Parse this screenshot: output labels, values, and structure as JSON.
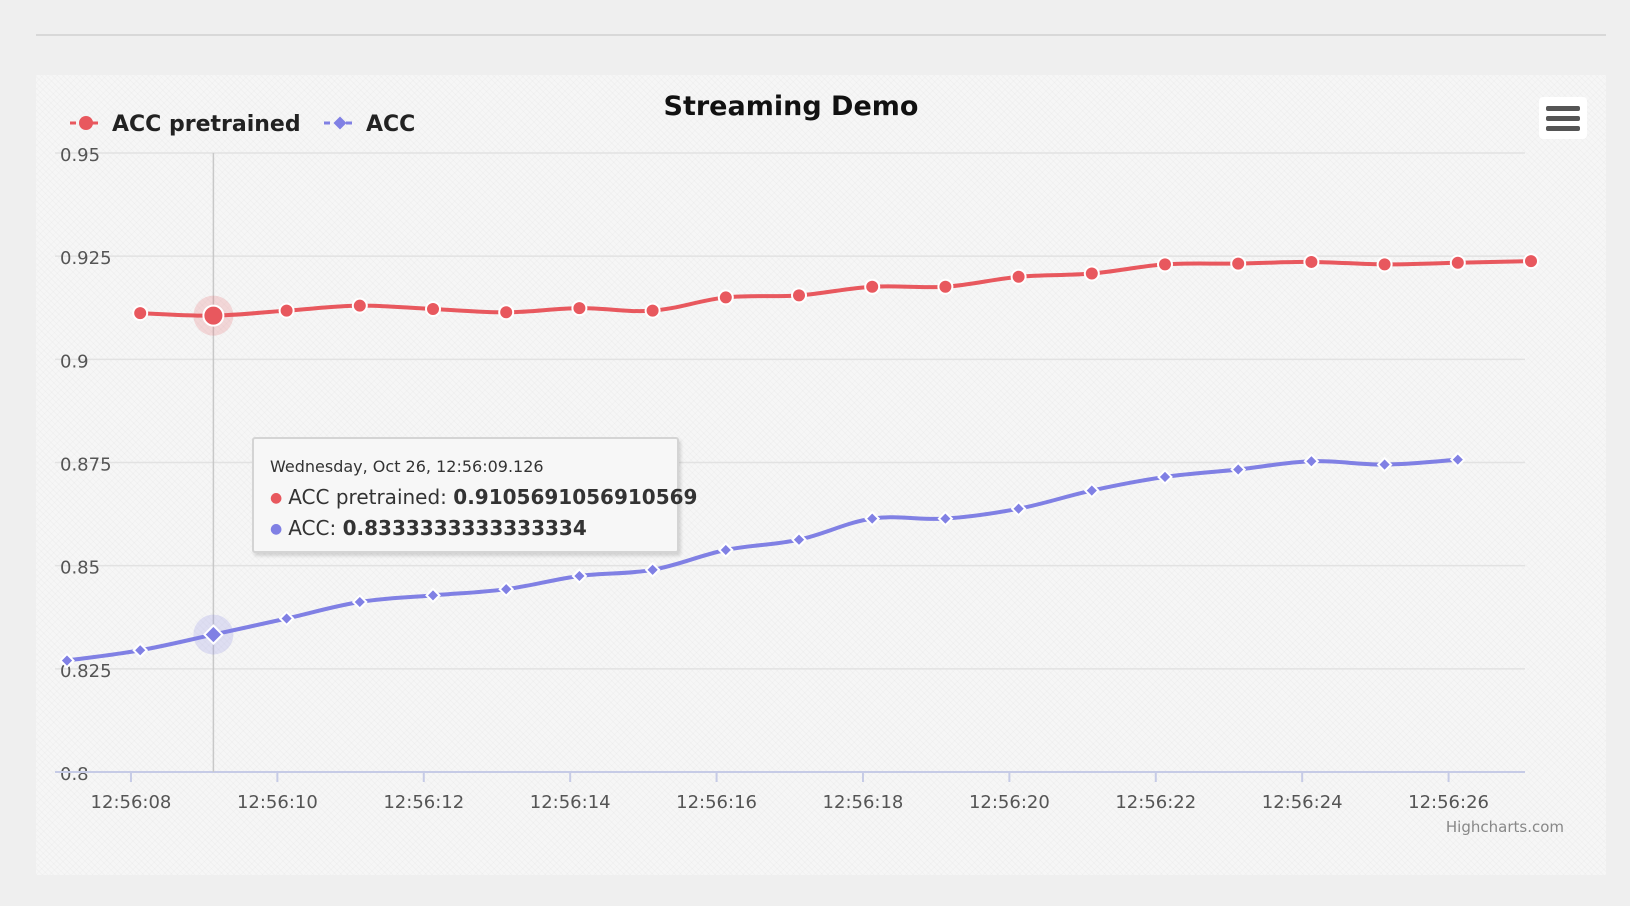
{
  "chart_data": {
    "type": "line",
    "title": "Streaming Demo",
    "xlabel": "",
    "ylabel": "",
    "x": [
      "12:56:07.126",
      "12:56:08.126",
      "12:56:09.126",
      "12:56:10.126",
      "12:56:11.126",
      "12:56:12.126",
      "12:56:13.126",
      "12:56:14.126",
      "12:56:15.126",
      "12:56:16.126",
      "12:56:17.126",
      "12:56:18.126",
      "12:56:19.126",
      "12:56:20.126",
      "12:56:21.126",
      "12:56:22.126",
      "12:56:23.126",
      "12:56:24.126",
      "12:56:25.126",
      "12:56:26.126",
      "12:56:27.126"
    ],
    "series": [
      {
        "name": "ACC pretrained",
        "color": "#e8585e",
        "marker": "circle",
        "values": [
          null,
          0.9112,
          0.9106,
          0.9118,
          0.913,
          0.9122,
          0.9114,
          0.9124,
          0.9118,
          0.915,
          0.9155,
          0.9176,
          0.9176,
          0.92,
          0.9208,
          0.923,
          0.9232,
          0.9236,
          0.923,
          0.9234,
          0.9238
        ]
      },
      {
        "name": "ACC",
        "color": "#8080e4",
        "marker": "diamond",
        "values": [
          0.827,
          0.8295,
          0.8333,
          0.8372,
          0.8412,
          0.8428,
          0.8443,
          0.8475,
          0.849,
          0.8538,
          0.8563,
          0.8614,
          0.8614,
          0.8638,
          0.8682,
          0.8715,
          0.8733,
          0.8753,
          0.8745,
          0.8757,
          null
        ]
      }
    ],
    "yticks": [
      "0.8",
      "0.825",
      "0.85",
      "0.875",
      "0.9",
      "0.925",
      "0.95"
    ],
    "xticks": [
      "12:56:08",
      "12:56:10",
      "12:56:12",
      "12:56:14",
      "12:56:16",
      "12:56:18",
      "12:56:20",
      "12:56:22",
      "12:56:24",
      "12:56:26"
    ],
    "ylim": [
      0.8,
      0.95
    ],
    "grid": true,
    "legend": "top-left",
    "hovered_index": 2
  },
  "tooltip": {
    "header": "Wednesday, Oct 26, 12:56:09.126",
    "rows": [
      {
        "name": "ACC pretrained",
        "value": "0.9105691056910569",
        "color": "#e8585e"
      },
      {
        "name": "ACC",
        "value": "0.8333333333333334",
        "color": "#8080e4"
      }
    ]
  },
  "credits": "Highcharts.com",
  "menu": {
    "icon": "hamburger-menu-icon"
  }
}
